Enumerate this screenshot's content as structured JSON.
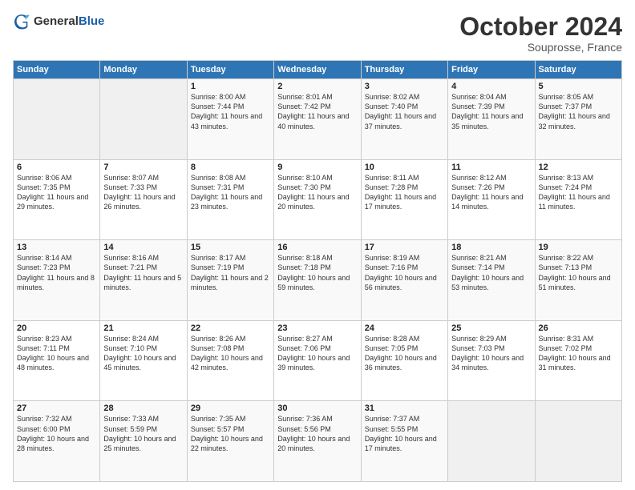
{
  "header": {
    "logo_general": "General",
    "logo_blue": "Blue",
    "title": "October 2024",
    "subtitle": "Souprosse, France"
  },
  "weekdays": [
    "Sunday",
    "Monday",
    "Tuesday",
    "Wednesday",
    "Thursday",
    "Friday",
    "Saturday"
  ],
  "weeks": [
    [
      {
        "day": "",
        "info": ""
      },
      {
        "day": "",
        "info": ""
      },
      {
        "day": "1",
        "info": "Sunrise: 8:00 AM\nSunset: 7:44 PM\nDaylight: 11 hours and 43 minutes."
      },
      {
        "day": "2",
        "info": "Sunrise: 8:01 AM\nSunset: 7:42 PM\nDaylight: 11 hours and 40 minutes."
      },
      {
        "day": "3",
        "info": "Sunrise: 8:02 AM\nSunset: 7:40 PM\nDaylight: 11 hours and 37 minutes."
      },
      {
        "day": "4",
        "info": "Sunrise: 8:04 AM\nSunset: 7:39 PM\nDaylight: 11 hours and 35 minutes."
      },
      {
        "day": "5",
        "info": "Sunrise: 8:05 AM\nSunset: 7:37 PM\nDaylight: 11 hours and 32 minutes."
      }
    ],
    [
      {
        "day": "6",
        "info": "Sunrise: 8:06 AM\nSunset: 7:35 PM\nDaylight: 11 hours and 29 minutes."
      },
      {
        "day": "7",
        "info": "Sunrise: 8:07 AM\nSunset: 7:33 PM\nDaylight: 11 hours and 26 minutes."
      },
      {
        "day": "8",
        "info": "Sunrise: 8:08 AM\nSunset: 7:31 PM\nDaylight: 11 hours and 23 minutes."
      },
      {
        "day": "9",
        "info": "Sunrise: 8:10 AM\nSunset: 7:30 PM\nDaylight: 11 hours and 20 minutes."
      },
      {
        "day": "10",
        "info": "Sunrise: 8:11 AM\nSunset: 7:28 PM\nDaylight: 11 hours and 17 minutes."
      },
      {
        "day": "11",
        "info": "Sunrise: 8:12 AM\nSunset: 7:26 PM\nDaylight: 11 hours and 14 minutes."
      },
      {
        "day": "12",
        "info": "Sunrise: 8:13 AM\nSunset: 7:24 PM\nDaylight: 11 hours and 11 minutes."
      }
    ],
    [
      {
        "day": "13",
        "info": "Sunrise: 8:14 AM\nSunset: 7:23 PM\nDaylight: 11 hours and 8 minutes."
      },
      {
        "day": "14",
        "info": "Sunrise: 8:16 AM\nSunset: 7:21 PM\nDaylight: 11 hours and 5 minutes."
      },
      {
        "day": "15",
        "info": "Sunrise: 8:17 AM\nSunset: 7:19 PM\nDaylight: 11 hours and 2 minutes."
      },
      {
        "day": "16",
        "info": "Sunrise: 8:18 AM\nSunset: 7:18 PM\nDaylight: 10 hours and 59 minutes."
      },
      {
        "day": "17",
        "info": "Sunrise: 8:19 AM\nSunset: 7:16 PM\nDaylight: 10 hours and 56 minutes."
      },
      {
        "day": "18",
        "info": "Sunrise: 8:21 AM\nSunset: 7:14 PM\nDaylight: 10 hours and 53 minutes."
      },
      {
        "day": "19",
        "info": "Sunrise: 8:22 AM\nSunset: 7:13 PM\nDaylight: 10 hours and 51 minutes."
      }
    ],
    [
      {
        "day": "20",
        "info": "Sunrise: 8:23 AM\nSunset: 7:11 PM\nDaylight: 10 hours and 48 minutes."
      },
      {
        "day": "21",
        "info": "Sunrise: 8:24 AM\nSunset: 7:10 PM\nDaylight: 10 hours and 45 minutes."
      },
      {
        "day": "22",
        "info": "Sunrise: 8:26 AM\nSunset: 7:08 PM\nDaylight: 10 hours and 42 minutes."
      },
      {
        "day": "23",
        "info": "Sunrise: 8:27 AM\nSunset: 7:06 PM\nDaylight: 10 hours and 39 minutes."
      },
      {
        "day": "24",
        "info": "Sunrise: 8:28 AM\nSunset: 7:05 PM\nDaylight: 10 hours and 36 minutes."
      },
      {
        "day": "25",
        "info": "Sunrise: 8:29 AM\nSunset: 7:03 PM\nDaylight: 10 hours and 34 minutes."
      },
      {
        "day": "26",
        "info": "Sunrise: 8:31 AM\nSunset: 7:02 PM\nDaylight: 10 hours and 31 minutes."
      }
    ],
    [
      {
        "day": "27",
        "info": "Sunrise: 7:32 AM\nSunset: 6:00 PM\nDaylight: 10 hours and 28 minutes."
      },
      {
        "day": "28",
        "info": "Sunrise: 7:33 AM\nSunset: 5:59 PM\nDaylight: 10 hours and 25 minutes."
      },
      {
        "day": "29",
        "info": "Sunrise: 7:35 AM\nSunset: 5:57 PM\nDaylight: 10 hours and 22 minutes."
      },
      {
        "day": "30",
        "info": "Sunrise: 7:36 AM\nSunset: 5:56 PM\nDaylight: 10 hours and 20 minutes."
      },
      {
        "day": "31",
        "info": "Sunrise: 7:37 AM\nSunset: 5:55 PM\nDaylight: 10 hours and 17 minutes."
      },
      {
        "day": "",
        "info": ""
      },
      {
        "day": "",
        "info": ""
      }
    ]
  ]
}
